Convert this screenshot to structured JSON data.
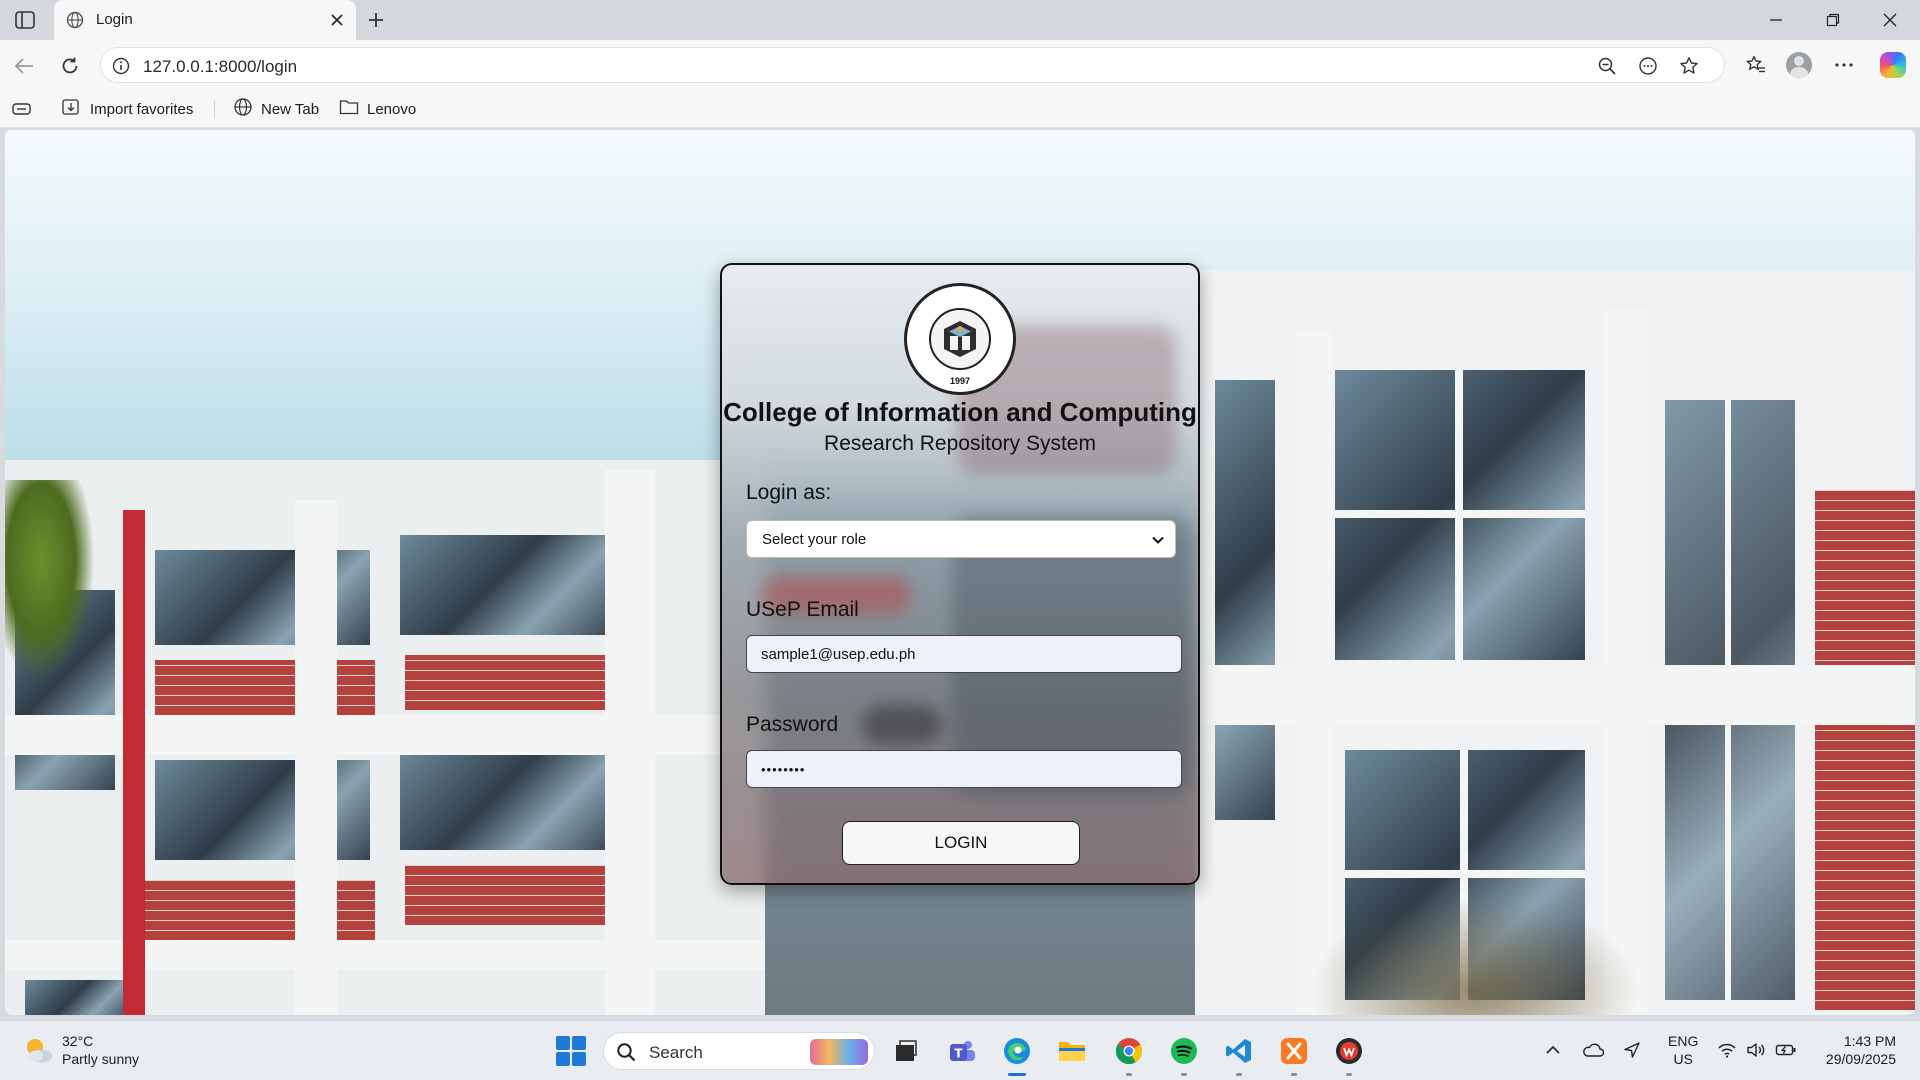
{
  "browser": {
    "tab_title": "Login",
    "url": "127.0.0.1:8000/login",
    "favorites": [
      {
        "label": "Import favorites",
        "icon": "import-favorites-icon"
      },
      {
        "label": "New Tab",
        "icon": "globe-icon"
      },
      {
        "label": "Lenovo",
        "icon": "folder-icon"
      }
    ]
  },
  "login": {
    "title": "College of Information and Computing",
    "subtitle": "Research Repository System",
    "logo_year": "1997",
    "role_label": "Login as:",
    "role_selected": "Select your role",
    "email_label": "USeP Email",
    "email_value": "sample1@usep.edu.ph",
    "password_label": "Password",
    "password_value": "••••••••",
    "login_button": "LOGIN"
  },
  "taskbar": {
    "weather_temp": "32°C",
    "weather_desc": "Partly sunny",
    "search_label": "Search",
    "lang_line1": "ENG",
    "lang_line2": "US",
    "time": "1:43 PM",
    "date": "29/09/2025"
  },
  "colors": {
    "start_blue": "#1f78d8",
    "card_border": "#111111",
    "brick_red": "#b4413c"
  }
}
